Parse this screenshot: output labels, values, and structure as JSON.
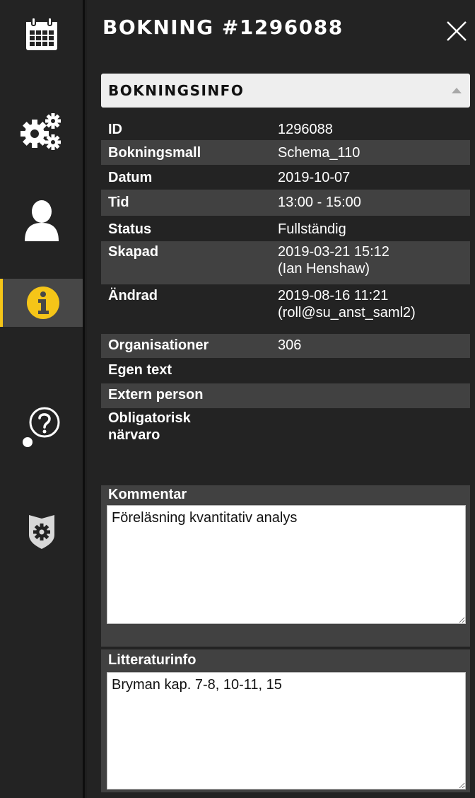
{
  "sidebar": {
    "items": [
      {
        "icon": "calendar-icon"
      },
      {
        "icon": "gears-icon"
      },
      {
        "icon": "user-icon"
      },
      {
        "icon": "info-icon",
        "active": true
      },
      {
        "icon": "help-icon"
      },
      {
        "icon": "shield-gear-icon"
      }
    ],
    "accent_color": "#f5c518"
  },
  "header": {
    "title": "BOKNING #1296088"
  },
  "section": {
    "title": "BOKNINGSINFO"
  },
  "info": {
    "id": {
      "label": "ID",
      "value": "1296088"
    },
    "template": {
      "label": "Bokningsmall",
      "value": "Schema_110"
    },
    "date": {
      "label": "Datum",
      "value": "2019-10-07"
    },
    "time": {
      "label": "Tid",
      "value": "13:00 - 15:00"
    },
    "status": {
      "label": "Status",
      "value": "Fullständig"
    },
    "created": {
      "label": "Skapad",
      "value_line1": "2019-03-21 15:12",
      "value_line2": "(Ian Henshaw)"
    },
    "changed": {
      "label": "Ändrad",
      "value_line1": "2019-08-16 11:21",
      "value_line2": "(roll@su_anst_saml2)"
    },
    "organisations": {
      "label": "Organisationer",
      "value": "306"
    },
    "own_text": {
      "label": "Egen text",
      "value": ""
    },
    "external_person": {
      "label": "Extern person",
      "value": ""
    },
    "mandatory": {
      "label_line1": "Obligatorisk",
      "label_line2": "närvaro",
      "value": ""
    }
  },
  "comment": {
    "label": "Kommentar",
    "value": "Föreläsning kvantitativ analys"
  },
  "literature": {
    "label": "Litteraturinfo",
    "value": "Bryman kap. 7-8, 10-11, 15"
  }
}
